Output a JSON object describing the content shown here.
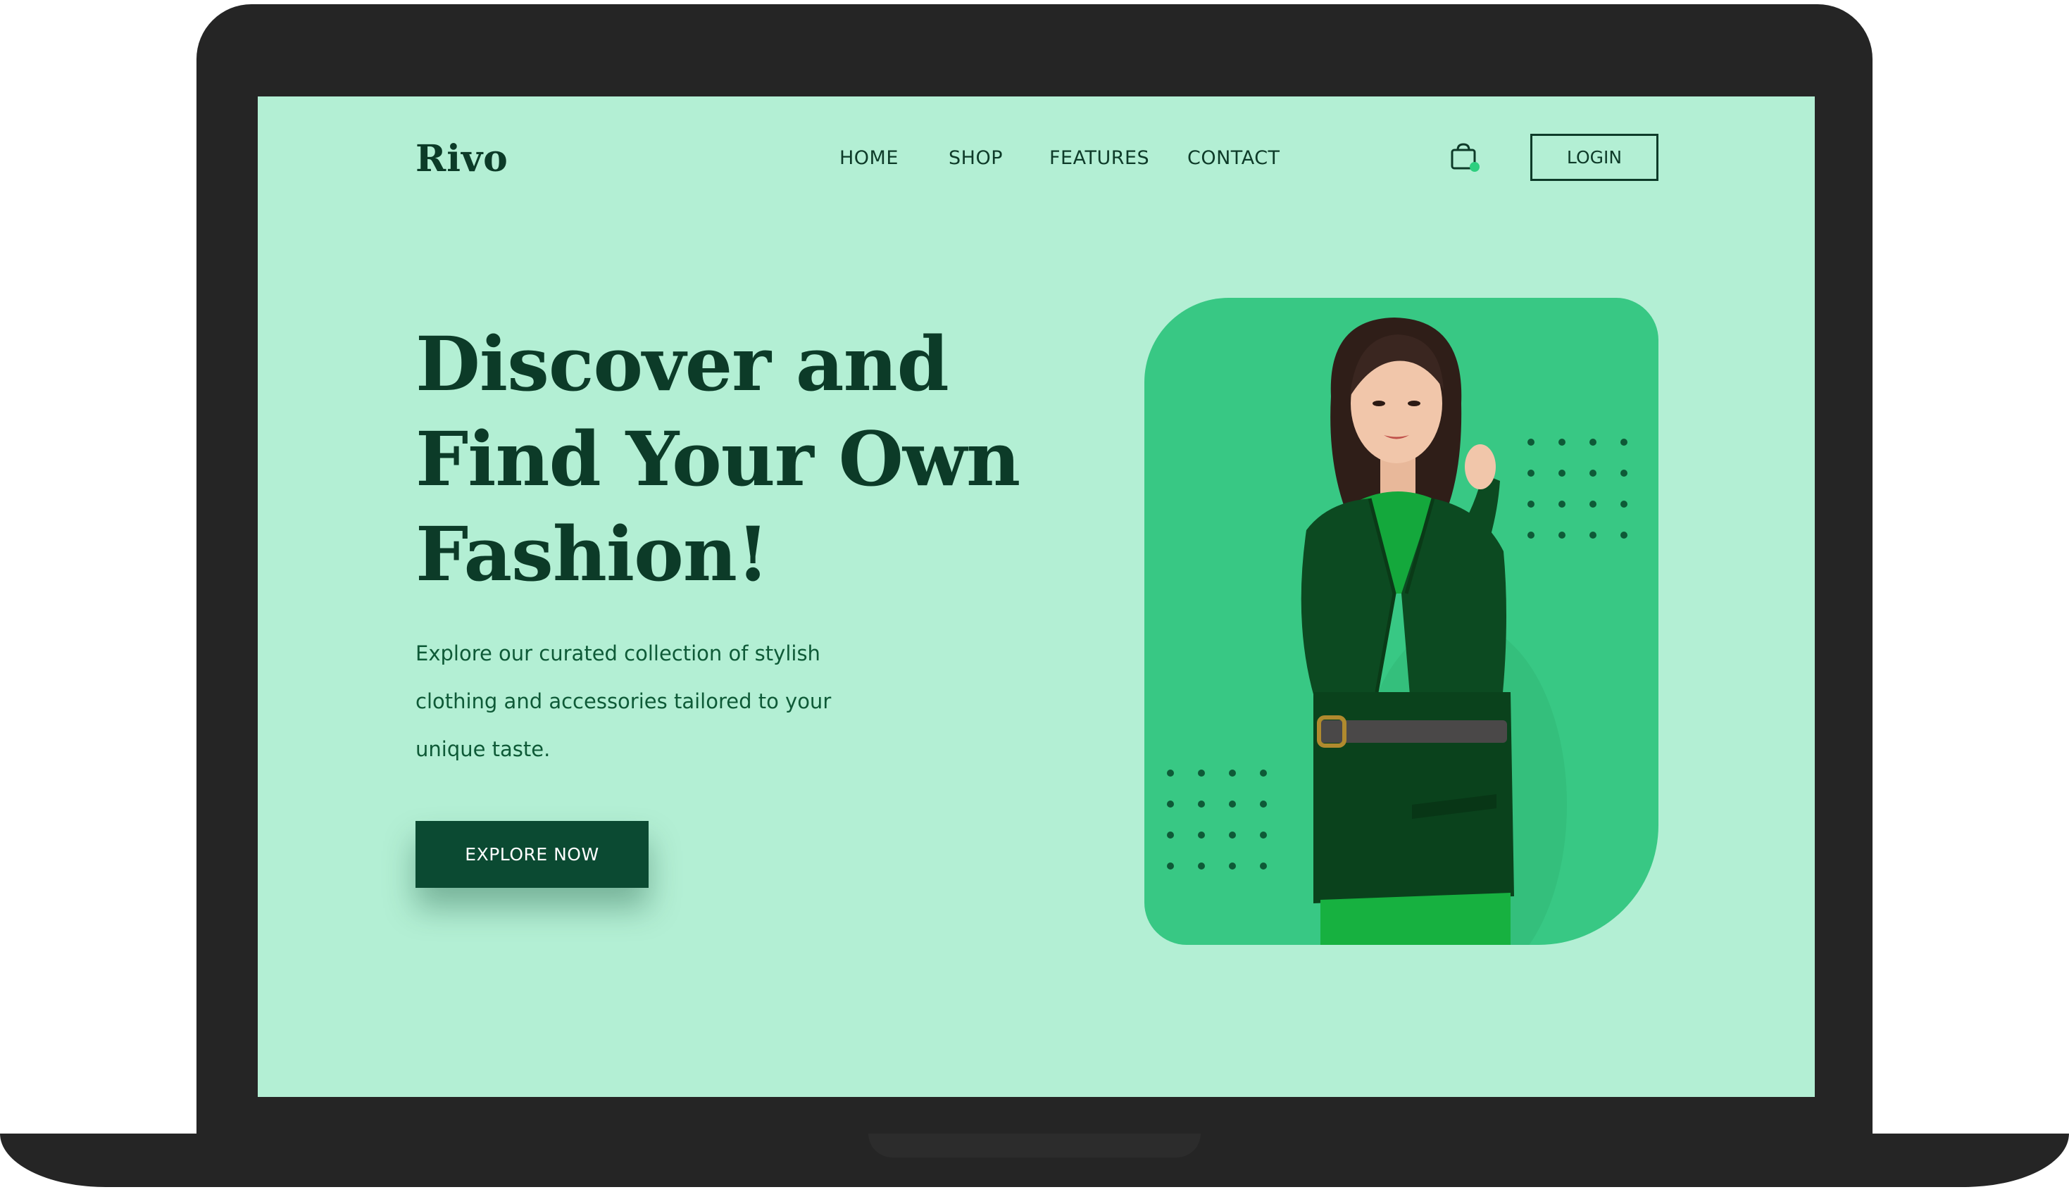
{
  "brand": {
    "logo": "Rivo"
  },
  "nav": {
    "links": [
      "HOME",
      "SHOP",
      "FEATURES",
      "CONTACT"
    ],
    "login_label": "LOGIN"
  },
  "hero": {
    "headline": [
      "Discover and",
      "Find Your Own",
      "Fashion!"
    ],
    "description": [
      "Explore our curated collection of stylish",
      "clothing and accessories tailored to your",
      "unique taste."
    ],
    "cta_label": "EXPLORE NOW"
  },
  "colors": {
    "background": "#b3efd4",
    "card": "#38c884",
    "primary_dark": "#0b4a32",
    "laptop_frame": "#252525",
    "cart_badge": "#2ecf7f"
  },
  "icons": {
    "cart": "shopping-bag-icon"
  }
}
